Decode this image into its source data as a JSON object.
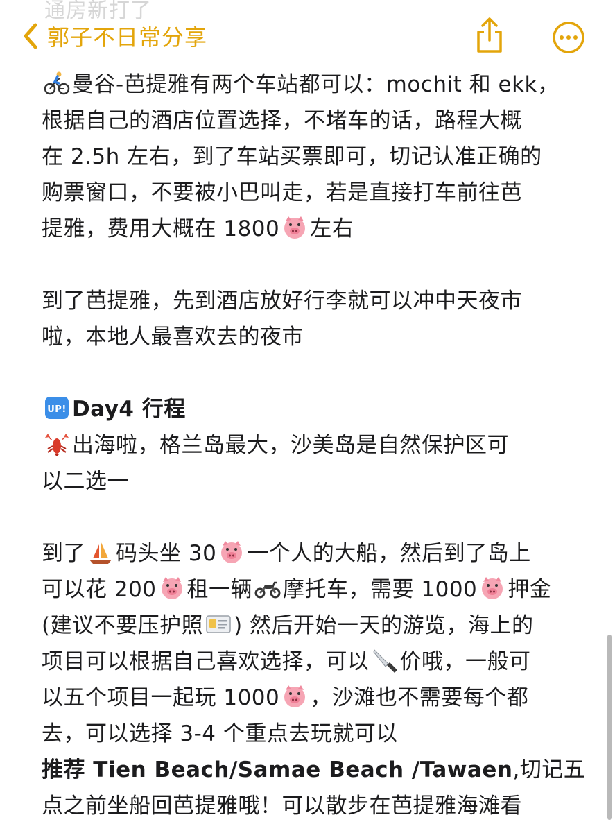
{
  "header": {
    "ghost_text": "通房新打了",
    "back_label": "郭子不日常分享"
  },
  "colors": {
    "accent": "#e3a50b",
    "text": "#1c1c1e"
  },
  "icons": {
    "back": "chevron-left-icon",
    "share": "share-icon",
    "more": "ellipsis-circle-icon"
  },
  "note": {
    "p1": {
      "l1": "曼谷-芭提雅有两个车站都可以：mochit 和 ekk，",
      "l2": "根据自己的酒店位置选择，不堵车的话，路程大概",
      "l3": "在 2.5h 左右，到了车站买票即可，切记认准正确的",
      "l4": "购票窗口，不要被小巴叫走，若是直接打车前往芭",
      "l5a": "提雅，费用大概在 1800",
      "l5b": "左右"
    },
    "p2": {
      "l1": "到了芭提雅，先到酒店放好行李就可以冲中天夜市",
      "l2": "啦，本地人最喜欢去的夜市"
    },
    "day4": {
      "badge": "UP!",
      "heading": "Day4 行程",
      "l1": "出海啦，格兰岛最大，沙美岛是自然保护区可",
      "l2": "以二选一"
    },
    "p3": {
      "l1a": "到了",
      "l1b": "码头坐 30",
      "l1c": "一个人的大船，然后到了岛上",
      "l2a": "可以花 200",
      "l2b": "租一辆",
      "l2c": "摩托车，需要 1000",
      "l2d": "押金",
      "l3a": "(建议不要压护照",
      "l3b": ") 然后开始一天的游览，海上的",
      "l4a": "项目可以根据自己喜欢选择，可以",
      "l4b": "价哦，一般可",
      "l5a": "以五个项目一起玩 1000",
      "l5b": "，沙滩也不需要每个都",
      "l6": "去，可以选择 3-4 个重点去玩就可以",
      "l7a": "推荐 Tien Beach/Samae Beach /Tawaen",
      "l7b": ",切记五",
      "l8": "点之前坐船回芭提雅哦！可以散步在芭提雅海滩看"
    }
  }
}
